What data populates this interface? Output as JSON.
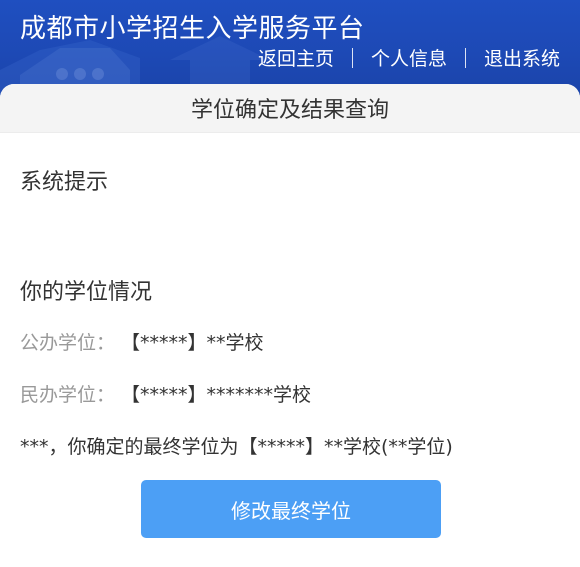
{
  "header": {
    "site_title": "成都市小学招生入学服务平台",
    "nav": [
      {
        "label": "返回主页"
      },
      {
        "label": "个人信息"
      },
      {
        "label": "退出系统"
      }
    ]
  },
  "card": {
    "title": "学位确定及结果查询",
    "system_notice_title": "系统提示",
    "status_title": "你的学位情况",
    "public_school": {
      "label": "公办学位：",
      "value": "【*****】**学校"
    },
    "private_school": {
      "label": "民办学位：",
      "value": "【*****】*******学校"
    },
    "final_statement": "***，你确定的最终学位为【*****】**学校(**学位)",
    "modify_button_label": "修改最终学位"
  },
  "colors": {
    "header_blue": "#1d49b5",
    "button_blue": "#4c9ff5",
    "label_gray": "#999999",
    "text_dark": "#333333"
  }
}
